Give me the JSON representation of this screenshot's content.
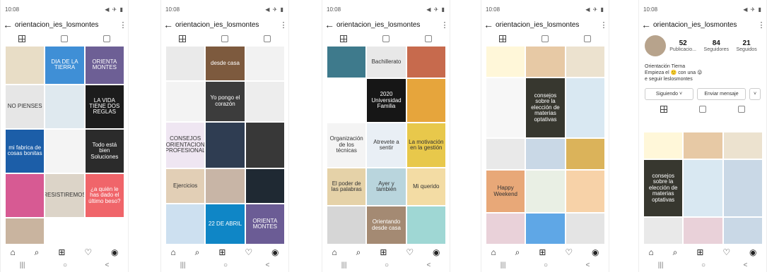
{
  "status_time": "10:08",
  "status_icons": "◀ ✈ ▮",
  "username": "orientacion_ies_losmontes",
  "back_icon": "arrow-left-icon",
  "more_icon": "vertical-dots-icon",
  "bottom_nav": [
    "⌂",
    "⌕",
    "⊞",
    "♡",
    "◉"
  ],
  "sys_nav": [
    "|||",
    "○",
    "<"
  ],
  "phone1": [
    {
      "t": "",
      "c": "#e8ddc6"
    },
    {
      "t": "DIA DE LA TIERRA",
      "c": "#3f8fd6"
    },
    {
      "t": "ORIENTA MONTES",
      "c": "#6d5f95"
    },
    {
      "t": "NO PIENSES",
      "c": "#e6e6e6"
    },
    {
      "t": "",
      "c": "#dfe9ef"
    },
    {
      "t": "LA VIDA TIENE DOS REGLAS",
      "c": "#1c1c1c"
    },
    {
      "t": "mi fabrica de cosas bonitas",
      "c": "#1c5ea8"
    },
    {
      "t": "",
      "c": "#f4f4f4"
    },
    {
      "t": "Todo está bien Soluciones",
      "c": "#2b2b2b"
    },
    {
      "t": "",
      "c": "#d75a93"
    },
    {
      "t": "RESISTIREMOS",
      "c": "#dcd4c8"
    },
    {
      "t": "¿a quién le has dado el último beso?",
      "c": "#f0656a"
    },
    {
      "t": "",
      "c": "#c9b49f"
    },
    {
      "t": "",
      "c": "#ffffff"
    },
    {
      "t": "",
      "c": "#ffffff"
    }
  ],
  "phone2": [
    {
      "t": "",
      "c": "#eaeaea"
    },
    {
      "t": "desde casa",
      "c": "#7d5a3e"
    },
    {
      "t": "",
      "c": "#f2f2f2"
    },
    {
      "t": "",
      "c": "#f3f3f3"
    },
    {
      "t": "Yo pongo el corazón",
      "c": "#3c3c3c"
    },
    {
      "t": "",
      "c": "#ededed"
    },
    {
      "t": "CONSEJOS ORIENTACION PROFESIONAL",
      "c": "#efe6f2"
    },
    {
      "t": "",
      "c": "#2f3d52"
    },
    {
      "t": "",
      "c": "#383838"
    },
    {
      "t": "Ejercicios",
      "c": "#e2cfb6"
    },
    {
      "t": "",
      "c": "#c8b5a6"
    },
    {
      "t": "",
      "c": "#1f2933"
    },
    {
      "t": "",
      "c": "#cde0f0"
    },
    {
      "t": "22 DE ABRIL",
      "c": "#0f86c6"
    },
    {
      "t": "ORIENTA MONTES",
      "c": "#6b5c95"
    }
  ],
  "phone3": [
    {
      "t": "",
      "c": "#3e7a8c"
    },
    {
      "t": "Bachillerato",
      "c": "#e8e8e8"
    },
    {
      "t": "",
      "c": "#c76a4d"
    },
    {
      "t": "",
      "c": "#ffffff"
    },
    {
      "t": "2020 Universidad Familia",
      "c": "#161616"
    },
    {
      "t": "",
      "c": "#e6a53c"
    },
    {
      "t": "Organización de los técnicas",
      "c": "#f4f4f4"
    },
    {
      "t": "Atrevete a sentir",
      "c": "#e9eff5"
    },
    {
      "t": "La motivación en la gestión",
      "c": "#e8c84b"
    },
    {
      "t": "El poder de las palabras",
      "c": "#e5d2a8"
    },
    {
      "t": "Ayer y también",
      "c": "#b9d5dd"
    },
    {
      "t": "Mi querido",
      "c": "#f3dca4"
    },
    {
      "t": "",
      "c": "#d6d6d6"
    },
    {
      "t": "Orientando desde casa",
      "c": "#a48a73"
    },
    {
      "t": "",
      "c": "#9fd7d4"
    }
  ],
  "phone4": [
    {
      "t": "",
      "c": "#fff7d9"
    },
    {
      "t": "",
      "c": "#e7c9a5"
    },
    {
      "t": "",
      "c": "#ece2cf"
    },
    {
      "t": "",
      "c": "#f7f7f7"
    },
    {
      "t": "consejos sobre la elección de materias optativas",
      "c": "#37372f"
    },
    {
      "t": "",
      "c": "#d9e8f2"
    },
    {
      "t": "",
      "c": "#e9e9e9"
    },
    {
      "t": "",
      "c": "#c9d8e6"
    },
    {
      "t": "",
      "c": "#dbb35a"
    },
    {
      "t": "Happy Weekend",
      "c": "#e8a878"
    },
    {
      "t": "",
      "c": "#e9efe4"
    },
    {
      "t": "",
      "c": "#f7d2a8"
    },
    {
      "t": "",
      "c": "#e9d1d9"
    },
    {
      "t": "",
      "c": "#5fa7e6"
    },
    {
      "t": "",
      "c": "#e4e4e4"
    }
  ],
  "phone5": {
    "stats": [
      {
        "n": "52",
        "l": "Publicacio..."
      },
      {
        "n": "84",
        "l": "Seguidores"
      },
      {
        "n": "21",
        "l": "Seguidos"
      }
    ],
    "name": "Orientación Tierna",
    "bio1": "Empieza el 🙂 con una 😜",
    "bio2": "e seguir leslosmontes",
    "btn_follow": "Siguiendo ˅",
    "btn_msg": "Enviar mensaje",
    "btn_more": "˅",
    "grid": [
      {
        "t": "",
        "c": "#fff7d9"
      },
      {
        "t": "",
        "c": "#e7c9a5"
      },
      {
        "t": "",
        "c": "#ece2cf"
      },
      {
        "t": "consejos sobre la elección de materias optativas",
        "c": "#37372f"
      },
      {
        "t": "",
        "c": "#d9e8f2"
      },
      {
        "t": "",
        "c": "#c9d8e6"
      },
      {
        "t": "",
        "c": "#e9e9e9"
      },
      {
        "t": "",
        "c": "#e9d1d9"
      },
      {
        "t": "",
        "c": "#c9d8e6"
      }
    ]
  }
}
